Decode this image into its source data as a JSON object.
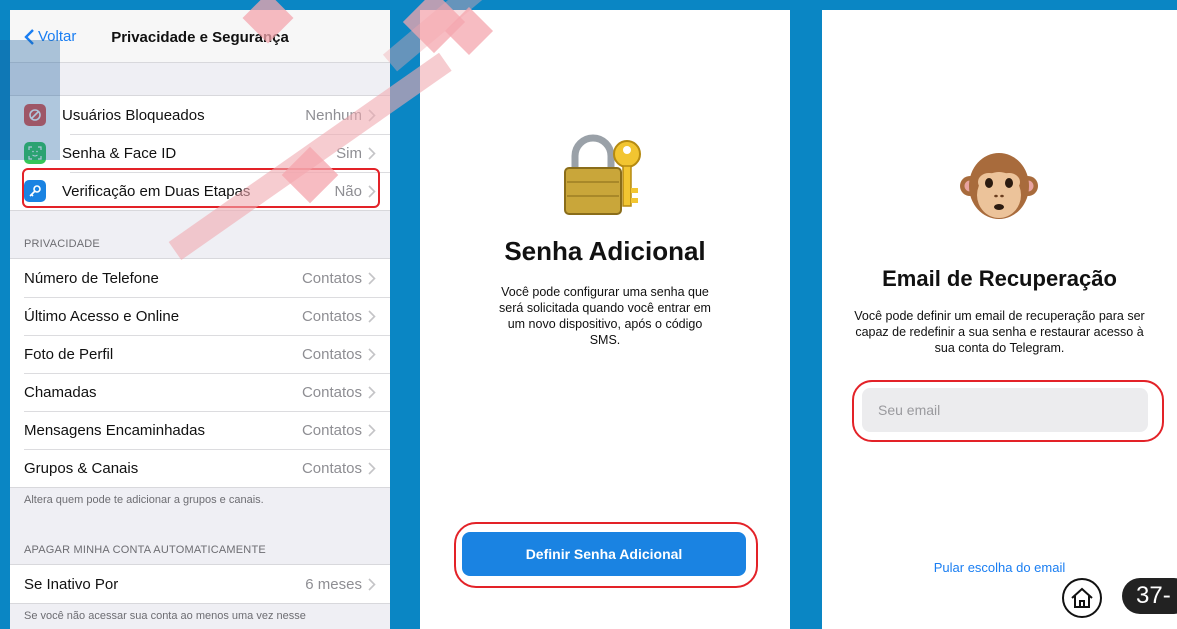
{
  "settings_screen": {
    "back_label": "Voltar",
    "title": "Privacidade e Segurança",
    "security_items": [
      {
        "label": "Usuários Bloqueados",
        "value": "Nenhum",
        "icon": "blocked-icon",
        "color": "#e5534b"
      },
      {
        "label": "Senha & Face ID",
        "value": "Sim",
        "icon": "face-id-icon",
        "color": "#35c759"
      },
      {
        "label": "Verificação em Duas Etapas",
        "value": "Não",
        "icon": "key-icon",
        "color": "#1a83e2"
      }
    ],
    "privacy_header": "PRIVACIDADE",
    "privacy_items": [
      {
        "label": "Número de Telefone",
        "value": "Contatos"
      },
      {
        "label": "Último Acesso e Online",
        "value": "Contatos"
      },
      {
        "label": "Foto de Perfil",
        "value": "Contatos"
      },
      {
        "label": "Chamadas",
        "value": "Contatos"
      },
      {
        "label": "Mensagens Encaminhadas",
        "value": "Contatos"
      },
      {
        "label": "Grupos & Canais",
        "value": "Contatos"
      }
    ],
    "privacy_footer": "Altera quem pode te adicionar a grupos e canais.",
    "delete_header": "APAGAR MINHA CONTA AUTOMATICAMENTE",
    "delete_item": {
      "label": "Se Inativo Por",
      "value": "6 meses"
    },
    "delete_footer": "Se você não acessar sua conta ao menos uma vez nesse"
  },
  "password_screen": {
    "title": "Senha Adicional",
    "description": "Você pode configurar uma senha que será solicitada quando você entrar em um novo dispositivo, após o código SMS.",
    "button_label": "Definir Senha Adicional"
  },
  "email_screen": {
    "title": "Email de Recuperação",
    "description": "Você pode definir um email de recuperação para ser capaz de redefinir a sua senha e restaurar acesso à sua conta do Telegram.",
    "email_placeholder": "Seu email",
    "skip_label": "Pular escolha do email"
  },
  "page_number": "37-",
  "colors": {
    "accent": "#1a83e2",
    "highlight": "#e32228",
    "background": "#0a86c4"
  }
}
